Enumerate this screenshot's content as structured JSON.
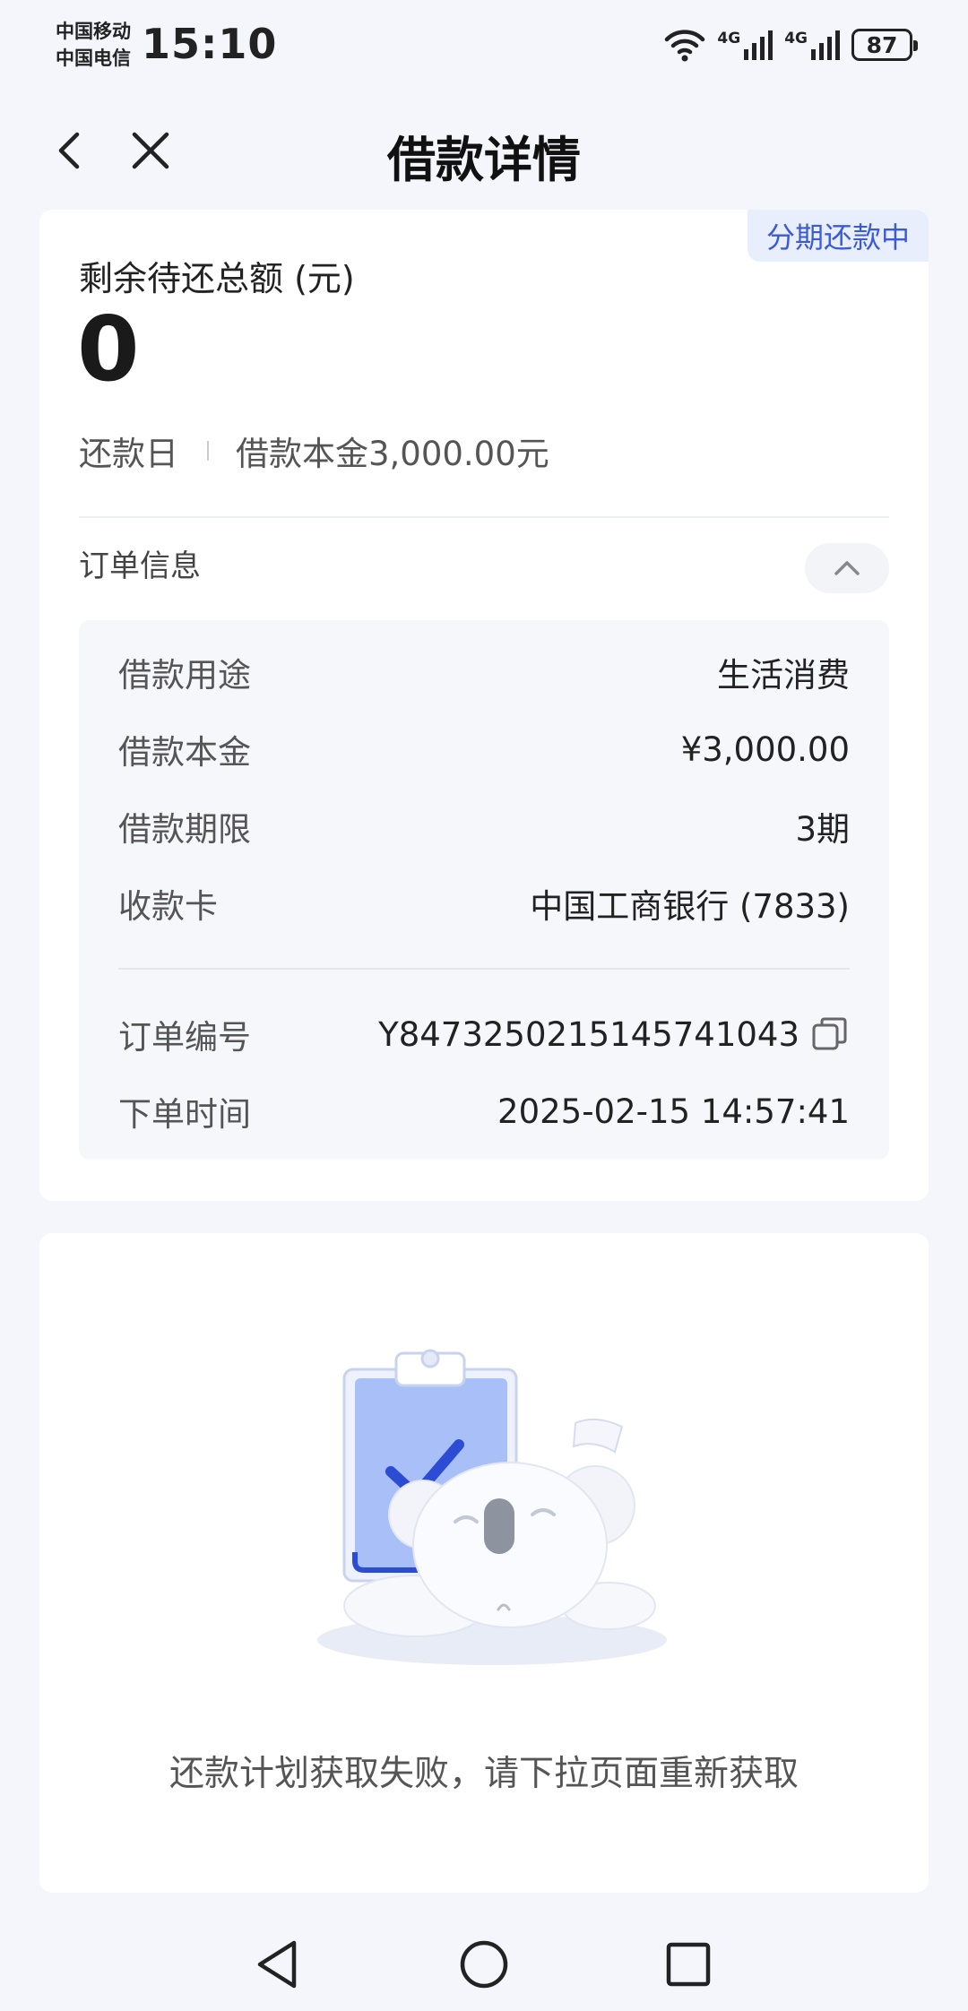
{
  "status_bar": {
    "carrier_1": "中国移动",
    "carrier_2": "中国电信",
    "time": "15:10",
    "net_1": "4G",
    "net_2": "4G",
    "battery": "87"
  },
  "nav": {
    "title": "借款详情",
    "back_icon": "chevron-left-icon",
    "close_icon": "close-icon"
  },
  "loan": {
    "status_tag": "分期还款中",
    "remaining_label": "剩余待还总额 (元)",
    "remaining_amount": "0",
    "repay_day_label": "还款日",
    "principal_summary": "借款本金3,000.00元"
  },
  "order": {
    "section_title": "订单信息",
    "rows": [
      {
        "label": "借款用途",
        "value": "生活消费"
      },
      {
        "label": "借款本金",
        "value": "¥3,000.00"
      },
      {
        "label": "借款期限",
        "value": "3期"
      },
      {
        "label": "收款卡",
        "value": "中国工商银行 (7833)"
      }
    ],
    "order_no_label": "订单编号",
    "order_no": "Y8473250215145741043",
    "order_time_label": "下单时间",
    "order_time": "2025-02-15 14:57:41"
  },
  "plan": {
    "message": "还款计划获取失败，请下拉页面重新获取"
  },
  "colors": {
    "accent": "#3b5bd6",
    "tag_bg": "#e9eefc",
    "page_bg": "#f4f6fc"
  }
}
